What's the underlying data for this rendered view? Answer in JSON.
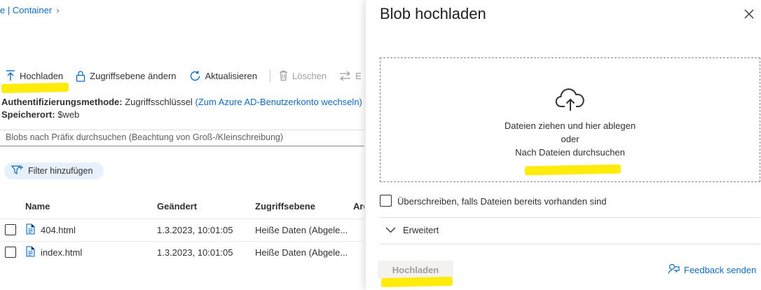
{
  "breadcrumb": {
    "prefix": "e | ",
    "current": "Container",
    "chevron": "›"
  },
  "toolbar": {
    "upload": "Hochladen",
    "change_tier": "Zugriffsebene ändern",
    "refresh": "Aktualisieren",
    "delete": "Löschen",
    "change_partial": "E"
  },
  "auth": {
    "label": "Authentifizierungsmethode:",
    "value": "Zugriffsschlüssel",
    "switch_link": "(Zum Azure AD-Benutzerkonto wechseln)"
  },
  "location": {
    "label": "Speicherort:",
    "value": "$web"
  },
  "search": {
    "placeholder": "Blobs nach Präfix durchsuchen (Beachtung von Groß-/Kleinschreibung)"
  },
  "filter": {
    "label": "Filter hinzufügen"
  },
  "table": {
    "columns": [
      "Name",
      "Geändert",
      "Zugriffsebene",
      "Arc"
    ],
    "rows": [
      {
        "name": "404.html",
        "modified": "1.3.2023, 10:01:05",
        "tier": "Heiße Daten (Abgele..."
      },
      {
        "name": "index.html",
        "modified": "1.3.2023, 10:01:05",
        "tier": "Heiße Daten (Abgele..."
      }
    ]
  },
  "panel": {
    "title": "Blob hochladen",
    "drop_text": "Dateien ziehen und hier ablegen",
    "or_text": "oder",
    "browse_link": "Nach Dateien durchsuchen",
    "overwrite_label": "Überschreiben, falls Dateien bereits vorhanden sind",
    "advanced_label": "Erweitert",
    "upload_button": "Hochladen",
    "feedback": "Feedback senden"
  },
  "colors": {
    "accent": "#0f6cbd",
    "highlight": "#ffeb00",
    "disabled": "#a19f9d"
  },
  "icons": [
    "upload-icon",
    "lock-icon",
    "refresh-icon",
    "trash-icon",
    "swap-icon",
    "filter-add-icon",
    "file-icon",
    "cloud-upload-icon",
    "close-icon",
    "chevron-down-icon",
    "feedback-icon"
  ]
}
